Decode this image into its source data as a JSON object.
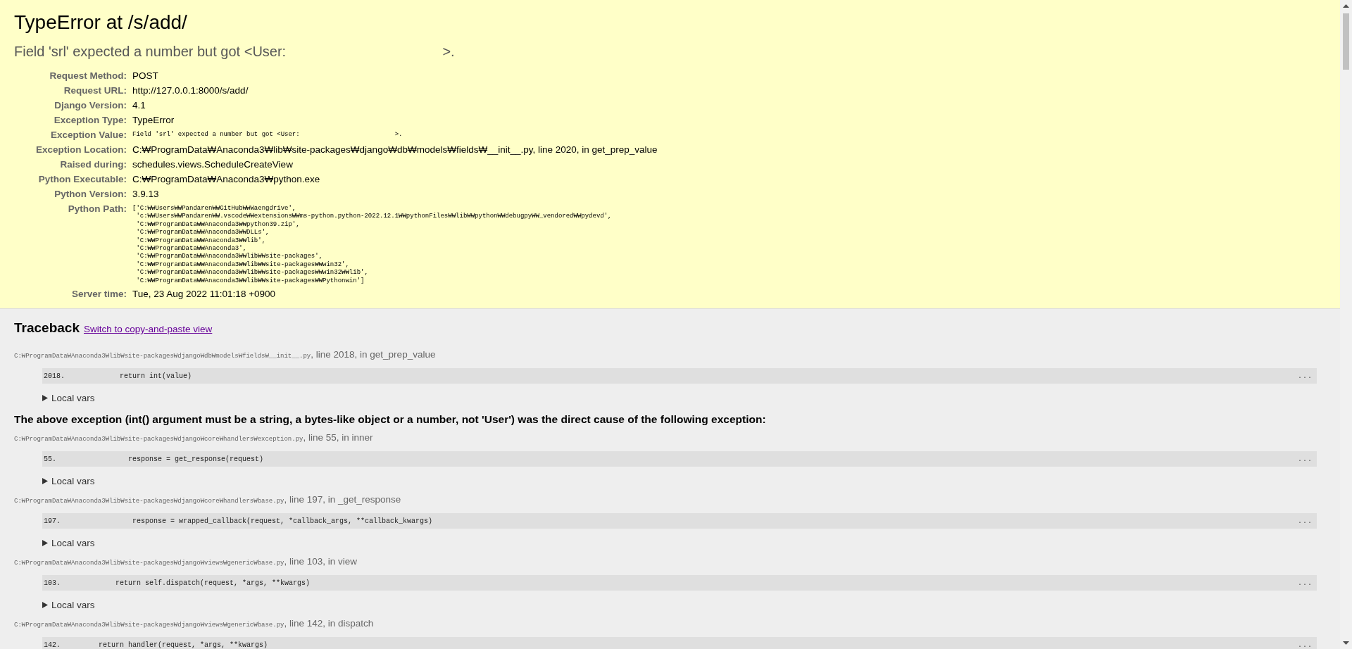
{
  "summary": {
    "title": "TypeError at /s/add/",
    "message": "Field 'srl' expected a number but got <User:                                        >.",
    "meta": [
      {
        "label": "Request Method:",
        "kind": "text",
        "value": "POST"
      },
      {
        "label": "Request URL:",
        "kind": "text",
        "value": "http://127.0.0.1:8000/s/add/"
      },
      {
        "label": "Django Version:",
        "kind": "text",
        "value": "4.1"
      },
      {
        "label": "Exception Type:",
        "kind": "text",
        "value": "TypeError"
      },
      {
        "label": "Exception Value:",
        "kind": "code",
        "value": "Field 'srl' expected a number but got <User:                         >."
      },
      {
        "label": "Exception Location:",
        "kind": "text",
        "value": "C:₩ProgramData₩Anaconda3₩lib₩site-packages₩django₩db₩models₩fields₩__init__.py, line 2020, in get_prep_value"
      },
      {
        "label": "Raised during:",
        "kind": "text",
        "value": "schedules.views.ScheduleCreateView"
      },
      {
        "label": "Python Executable:",
        "kind": "text",
        "value": "C:₩ProgramData₩Anaconda3₩python.exe"
      },
      {
        "label": "Python Version:",
        "kind": "text",
        "value": "3.9.13"
      },
      {
        "label": "Python Path:",
        "kind": "lines",
        "lines": [
          "['C:₩₩Users₩₩Pandaren₩₩GitHub₩₩Waengdrive',",
          " 'c:₩₩Users₩₩Pandaren₩₩.vscode₩₩extensions₩₩ms-python.python-2022.12.1₩₩pythonFiles₩₩lib₩₩python₩₩debugpy₩₩_vendored₩₩pydevd',",
          " 'C:₩₩ProgramData₩₩Anaconda3₩₩python39.zip',",
          " 'C:₩₩ProgramData₩₩Anaconda3₩₩DLLs',",
          " 'C:₩₩ProgramData₩₩Anaconda3₩₩lib',",
          " 'C:₩₩ProgramData₩₩Anaconda3',",
          " 'C:₩₩ProgramData₩₩Anaconda3₩₩lib₩₩site-packages',",
          " 'C:₩₩ProgramData₩₩Anaconda3₩₩lib₩₩site-packages₩₩win32',",
          " 'C:₩₩ProgramData₩₩Anaconda3₩₩lib₩₩site-packages₩₩win32₩₩lib',",
          " 'C:₩₩ProgramData₩₩Anaconda3₩₩lib₩₩site-packages₩₩Pythonwin']"
        ]
      },
      {
        "label": "Server time:",
        "kind": "text",
        "value": "Tue, 23 Aug 2022 11:01:18 +0900"
      }
    ]
  },
  "traceback": {
    "title": "Traceback",
    "link": "Switch to copy-and-paste view",
    "items": [
      {
        "kind": "frame",
        "file": "C:₩ProgramData₩Anaconda3₩lib₩site-packages₩django₩db₩models₩fields₩__init__.py",
        "where": ", line 2018, in get_prep_value",
        "line_no": "2018.",
        "code": "             return int(value)",
        "more": "...",
        "vars": "Local vars"
      },
      {
        "kind": "cause",
        "text": "The above exception (int() argument must be a string, a bytes-like object or a number, not 'User') was the direct cause of the following exception:"
      },
      {
        "kind": "frame",
        "file": "C:₩ProgramData₩Anaconda3₩lib₩site-packages₩django₩core₩handlers₩exception.py",
        "where": ", line 55, in inner",
        "line_no": "55.",
        "code": "                 response = get_response(request)",
        "more": "...",
        "vars": "Local vars"
      },
      {
        "kind": "frame",
        "file": "C:₩ProgramData₩Anaconda3₩lib₩site-packages₩django₩core₩handlers₩base.py",
        "where": ", line 197, in _get_response",
        "line_no": "197.",
        "code": "                 response = wrapped_callback(request, *callback_args, **callback_kwargs)",
        "more": "...",
        "vars": "Local vars"
      },
      {
        "kind": "frame",
        "file": "C:₩ProgramData₩Anaconda3₩lib₩site-packages₩django₩views₩generic₩base.py",
        "where": ", line 103, in view",
        "line_no": "103.",
        "code": "             return self.dispatch(request, *args, **kwargs)",
        "more": "...",
        "vars": "Local vars"
      },
      {
        "kind": "frame",
        "file": "C:₩ProgramData₩Anaconda3₩lib₩site-packages₩django₩views₩generic₩base.py",
        "where": ", line 142, in dispatch",
        "line_no": "142.",
        "code": "         return handler(request, *args, **kwargs)",
        "more": "..."
      }
    ]
  }
}
